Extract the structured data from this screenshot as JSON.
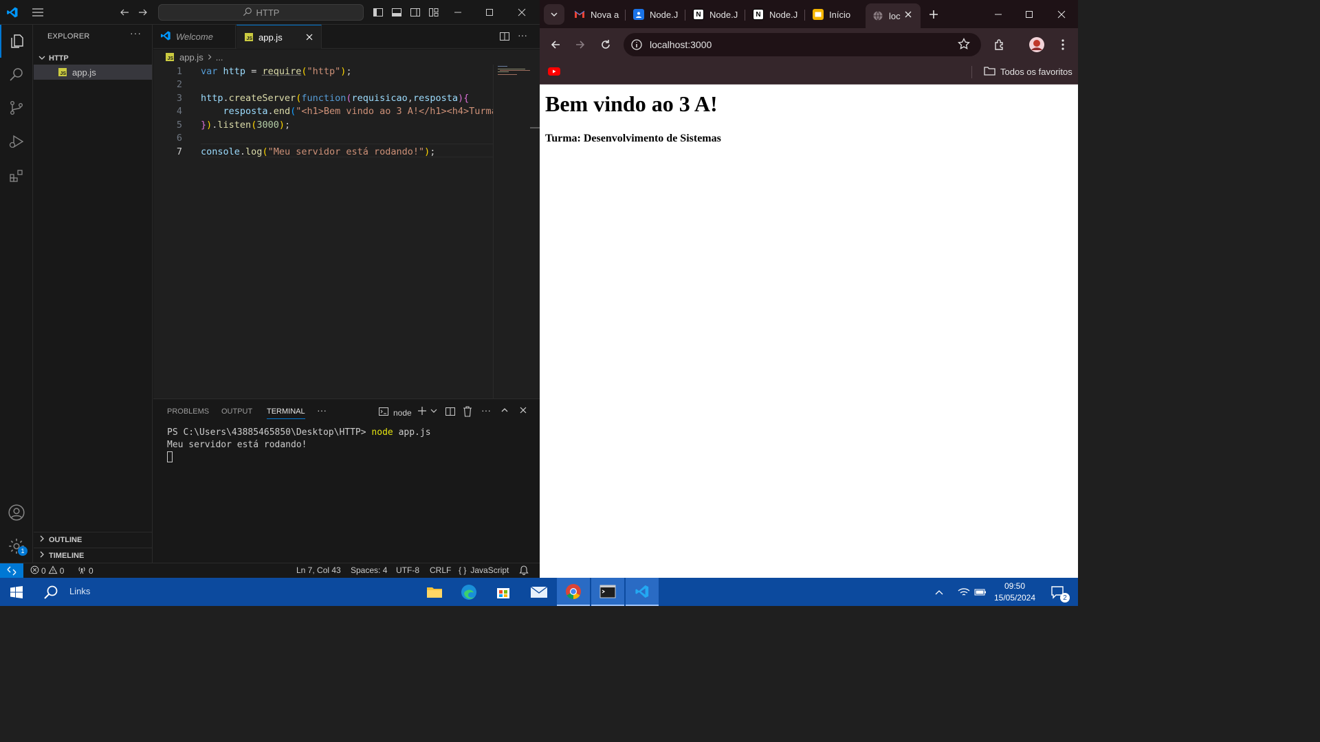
{
  "vscode": {
    "search_text": "HTTP",
    "sidebar": {
      "title": "EXPLORER",
      "more": "···",
      "folder": "HTTP",
      "file": "app.js",
      "outline": "OUTLINE",
      "timeline": "TIMELINE"
    },
    "tabs": [
      {
        "label": "Welcome"
      },
      {
        "label": "app.js"
      }
    ],
    "breadcrumb": {
      "file": "app.js",
      "rest": "..."
    },
    "editor": {
      "line_numbers": [
        "1",
        "2",
        "3",
        "4",
        "5",
        "6",
        "7"
      ],
      "current_line": 7
    },
    "panel": {
      "tabs": [
        "PROBLEMS",
        "OUTPUT",
        "TERMINAL"
      ],
      "more": "···",
      "active_tab": "TERMINAL",
      "terminal_name": "node",
      "terminal_prompt": "PS C:\\Users\\43885465850\\Desktop\\HTTP>",
      "terminal_command": "node",
      "terminal_arg": "app.js",
      "terminal_output": "Meu servidor está rodando!"
    },
    "status": {
      "errors": "0",
      "warnings": "0",
      "ports": "0",
      "position": "Ln 7, Col 43",
      "spaces": "Spaces: 4",
      "encoding": "UTF-8",
      "eol": "CRLF",
      "language": "JavaScript",
      "settings_badge": "1"
    }
  },
  "chrome": {
    "tabs": [
      {
        "label": "Nova a",
        "icon": "gmail-icon"
      },
      {
        "label": "Node.J",
        "icon": "classroom-icon"
      },
      {
        "label": "Node.J",
        "icon": "notion-icon"
      },
      {
        "label": "Node.J",
        "icon": "notion-icon"
      },
      {
        "label": "Início",
        "icon": "slides-icon"
      },
      {
        "label": "loc",
        "icon": "globe-icon"
      }
    ],
    "url": "localhost:3000",
    "bookmarks_folder": "Todos os favoritos",
    "page": {
      "h1": "Bem vindo ao 3 A!",
      "h4": "Turma: Desenvolvimento de Sistemas"
    }
  },
  "taskbar": {
    "search_label": "Links",
    "time": "09:50",
    "date": "15/05/2024",
    "notification_count": "2"
  }
}
